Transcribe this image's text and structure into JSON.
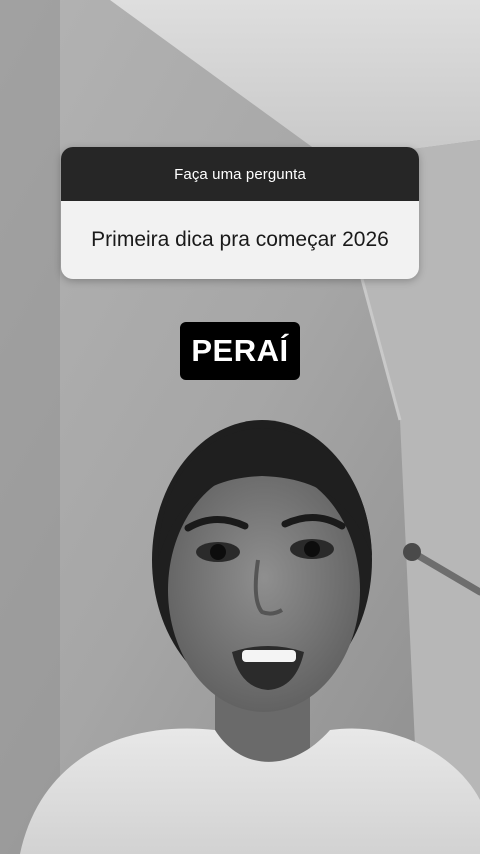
{
  "question_box": {
    "header": "Faça uma pergunta",
    "question": "Primeira dica pra começar 2026"
  },
  "caption": {
    "text": "PERAÍ"
  },
  "colors": {
    "header_bg": "#262626",
    "body_bg": "#f2f2f2",
    "caption_bg": "#000000"
  }
}
